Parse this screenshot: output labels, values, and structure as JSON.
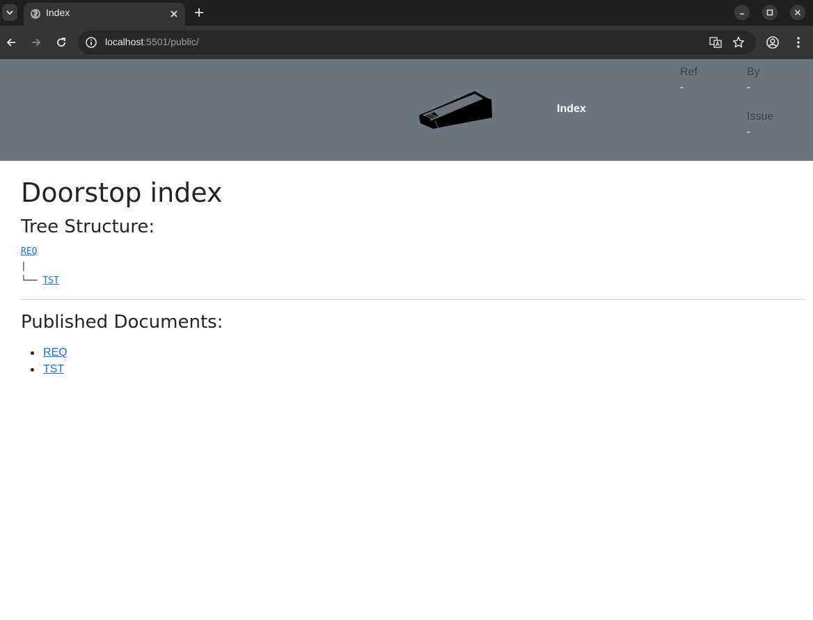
{
  "browser": {
    "tab": {
      "title": "Index"
    },
    "url": {
      "host": "localhost",
      "rest": ":5501/public/"
    }
  },
  "header": {
    "title": "Index",
    "meta": {
      "ref_label": "Ref",
      "ref_value": "-",
      "by_label": "By",
      "by_value": "-",
      "issue_label": "Issue",
      "issue_value": "-"
    }
  },
  "main": {
    "title": "Doorstop index",
    "tree_heading": "Tree Structure:",
    "tree": {
      "root": "REQ",
      "pipe": "|",
      "branch": "└── ",
      "child": "TST"
    },
    "published_heading": "Published Documents:",
    "documents": [
      "REQ",
      "TST"
    ]
  },
  "colors": {
    "header_bg": "#6c757d",
    "link": "#0d6efd",
    "chrome_dark": "#1f1f1f",
    "chrome_toolbar": "#353535"
  }
}
